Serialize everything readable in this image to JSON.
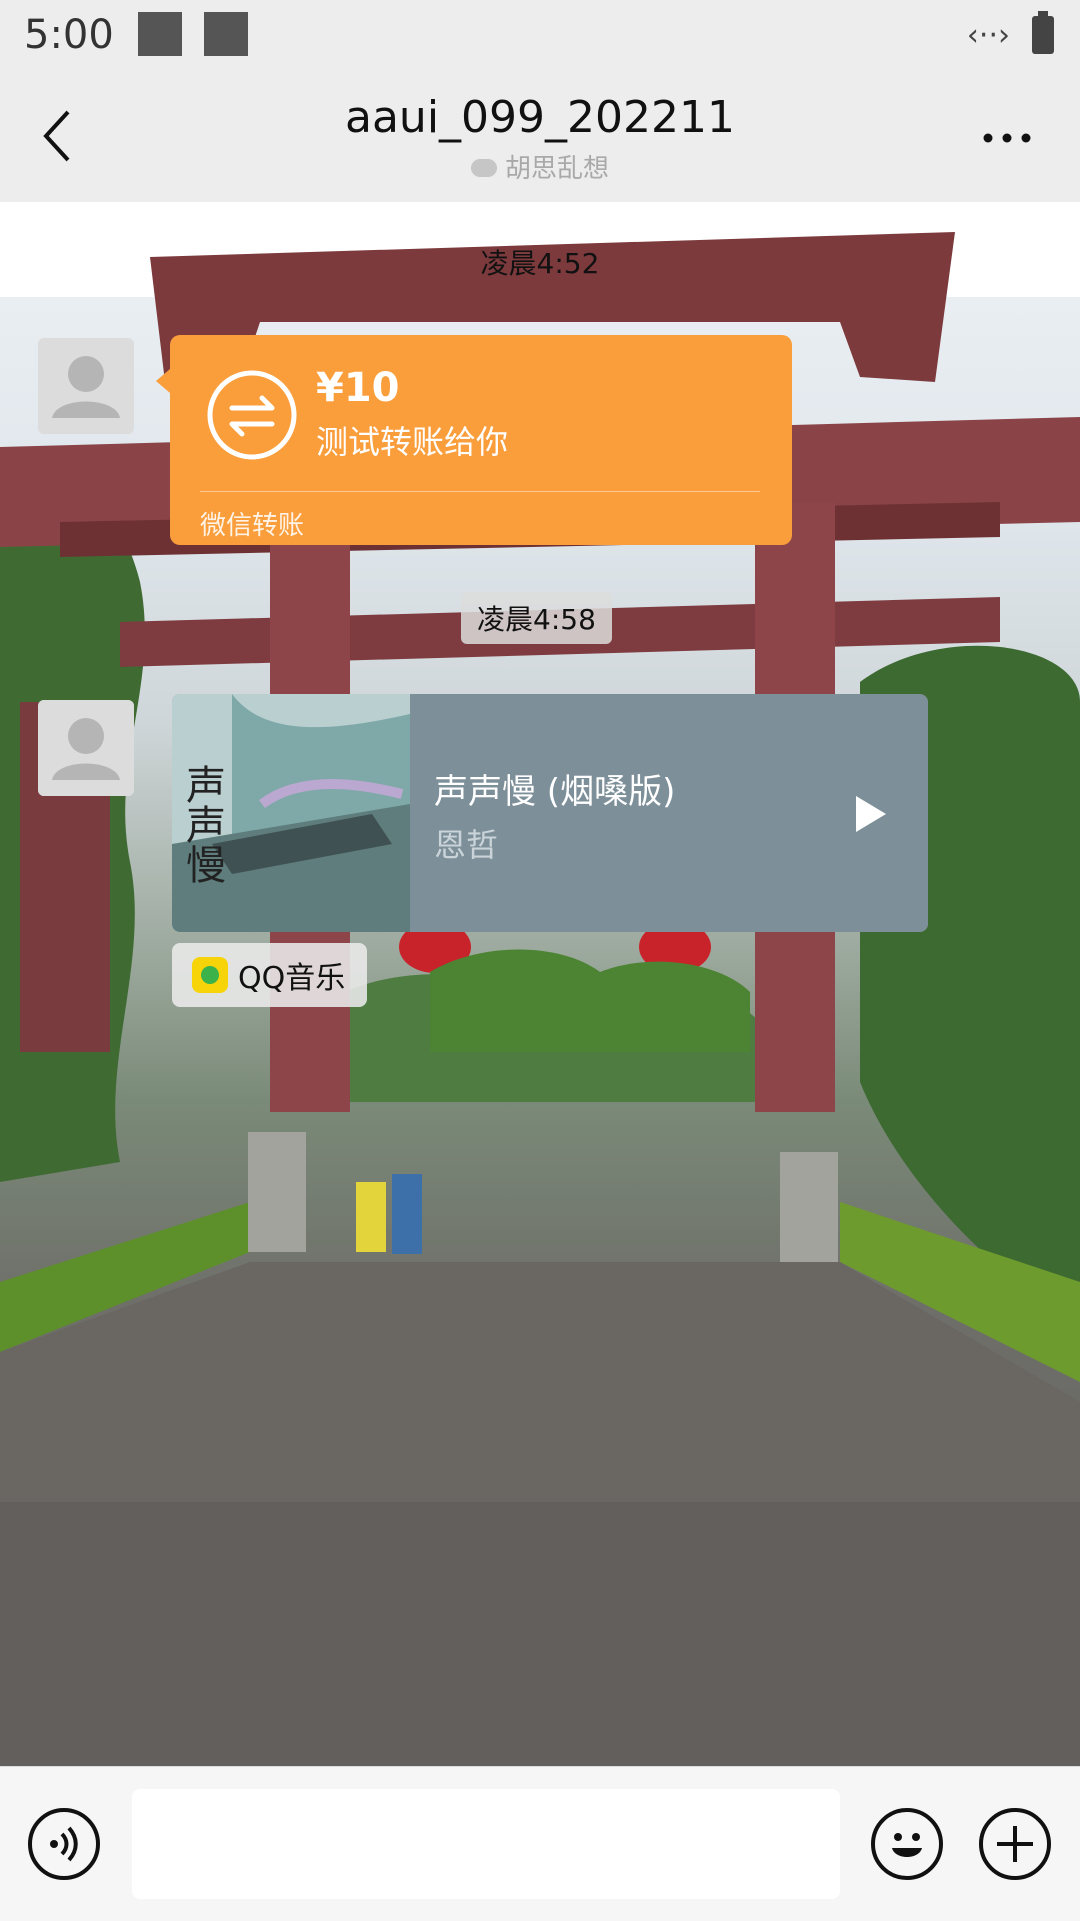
{
  "status_bar": {
    "time": "5:00",
    "data_indicator": "‹··›"
  },
  "header": {
    "title": "aaui_099_202211",
    "subtitle": "胡思乱想"
  },
  "messages": {
    "time_1": "凌晨4:52",
    "transfer": {
      "amount": "¥10",
      "note": "测试转账给你",
      "footer": "微信转账"
    },
    "time_2": "凌晨4:58",
    "music": {
      "title": "声声慢 (烟嗓版)",
      "artist": "恩哲",
      "cover_text": "声声慢"
    },
    "source": {
      "label": "QQ音乐"
    }
  },
  "input": {
    "value": "",
    "placeholder": ""
  },
  "colors": {
    "transfer": "#fa9d3b",
    "music_card": "#7d8f99",
    "header": "#ededed"
  },
  "icons": [
    "back-icon",
    "more-icon",
    "transfer-icon",
    "play-icon",
    "qq-music-icon",
    "voice-icon",
    "emoji-icon",
    "plus-icon",
    "avatar-placeholder-icon",
    "chat-bubble-icon"
  ]
}
